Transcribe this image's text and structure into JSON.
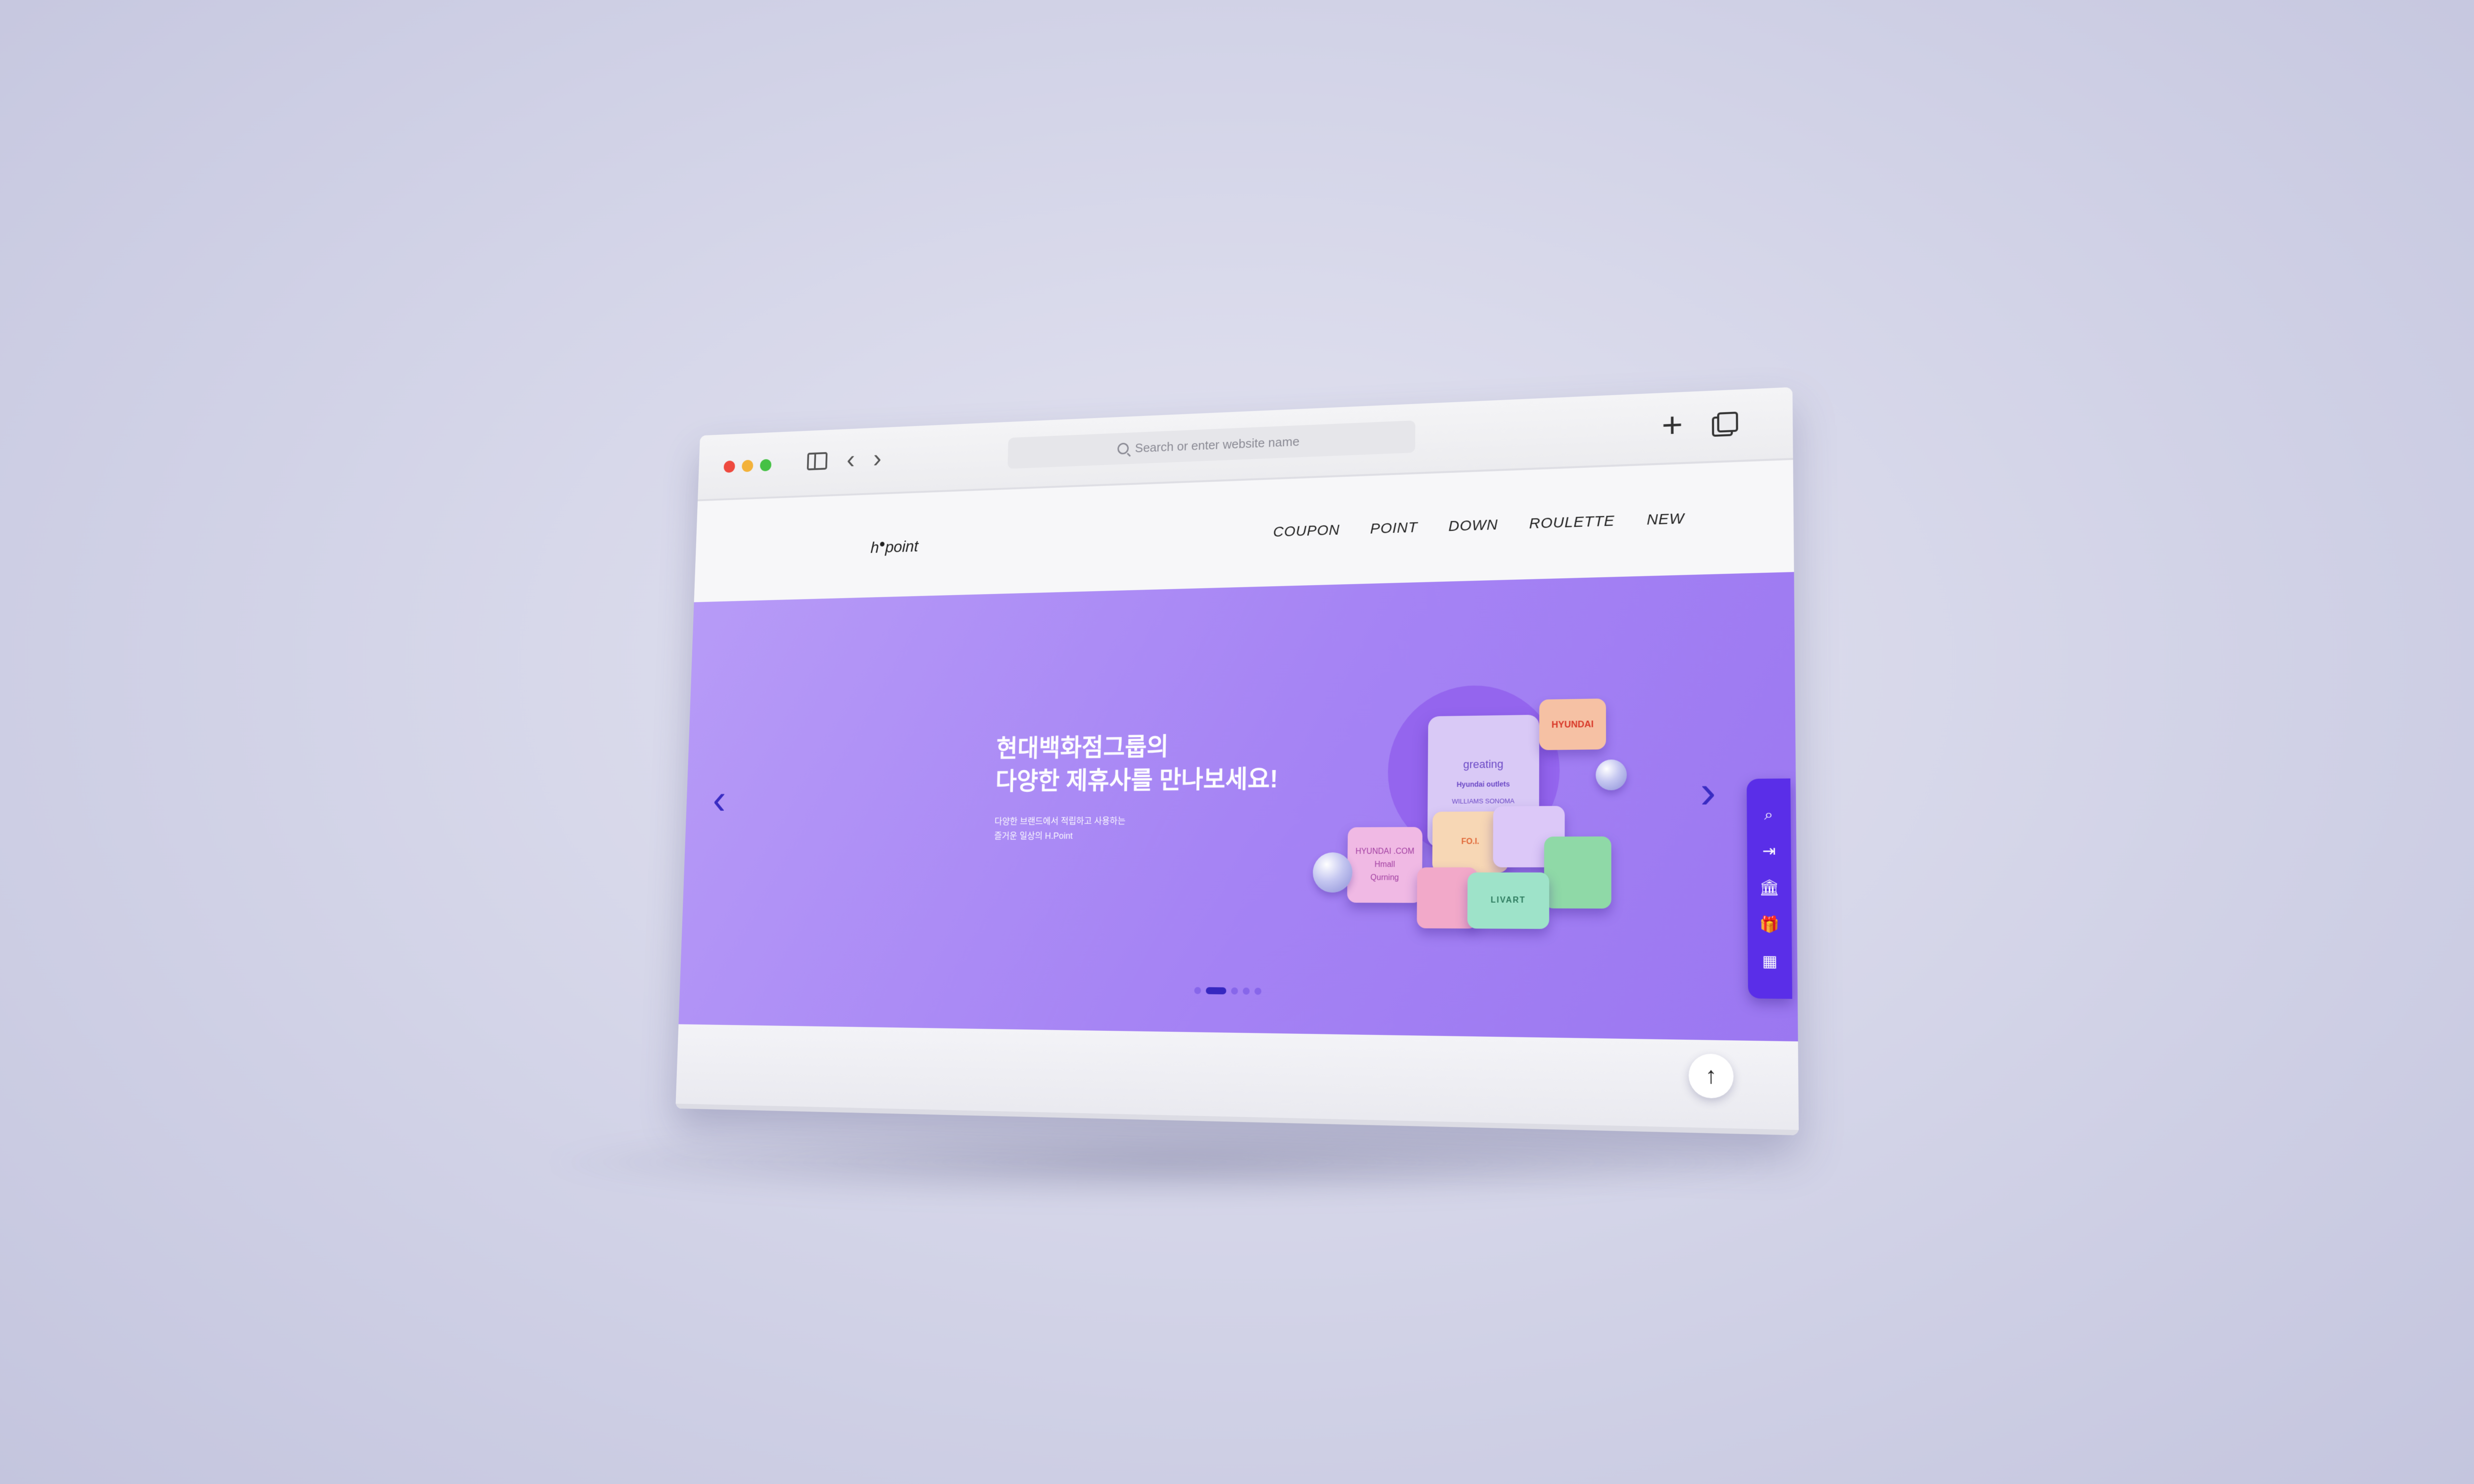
{
  "browser": {
    "address_placeholder": "Search or enter website name"
  },
  "site": {
    "logo_text": "h point",
    "menu": [
      "COUPON",
      "POINT",
      "DOWN",
      "ROULETTE",
      "NEW"
    ]
  },
  "hero": {
    "title_line1": "현대백화점그룹의",
    "title_line2": "다양한 제휴사를 만나보세요!",
    "subtitle_line1": "다양한 브랜드에서 적립하고 사용하는",
    "subtitle_line2": "즐거운 일상의 H.Point",
    "pagination_total": 5,
    "pagination_active": 2
  },
  "illustration": {
    "card_brand_1": "greating",
    "card_brand_2": "Hyundai outlets",
    "card_brand_3": "WILLIAMS SONOMA",
    "bubble_brand": "HYUNDAI",
    "piece_brand_1": "HYUNDAI .COM",
    "piece_brand_2": "Hmall",
    "piece_brand_3": "Qurning",
    "piece_brand_4": "FO.I.",
    "piece_brand_5": "LIVART"
  },
  "quickbar_icons": [
    "search-icon",
    "login-icon",
    "bank-icon",
    "gift-icon",
    "building-icon"
  ],
  "colors": {
    "hero_start": "#b79bf7",
    "hero_end": "#9b77f1",
    "accent": "#5a2ee8",
    "pager_active": "#3627c0"
  }
}
